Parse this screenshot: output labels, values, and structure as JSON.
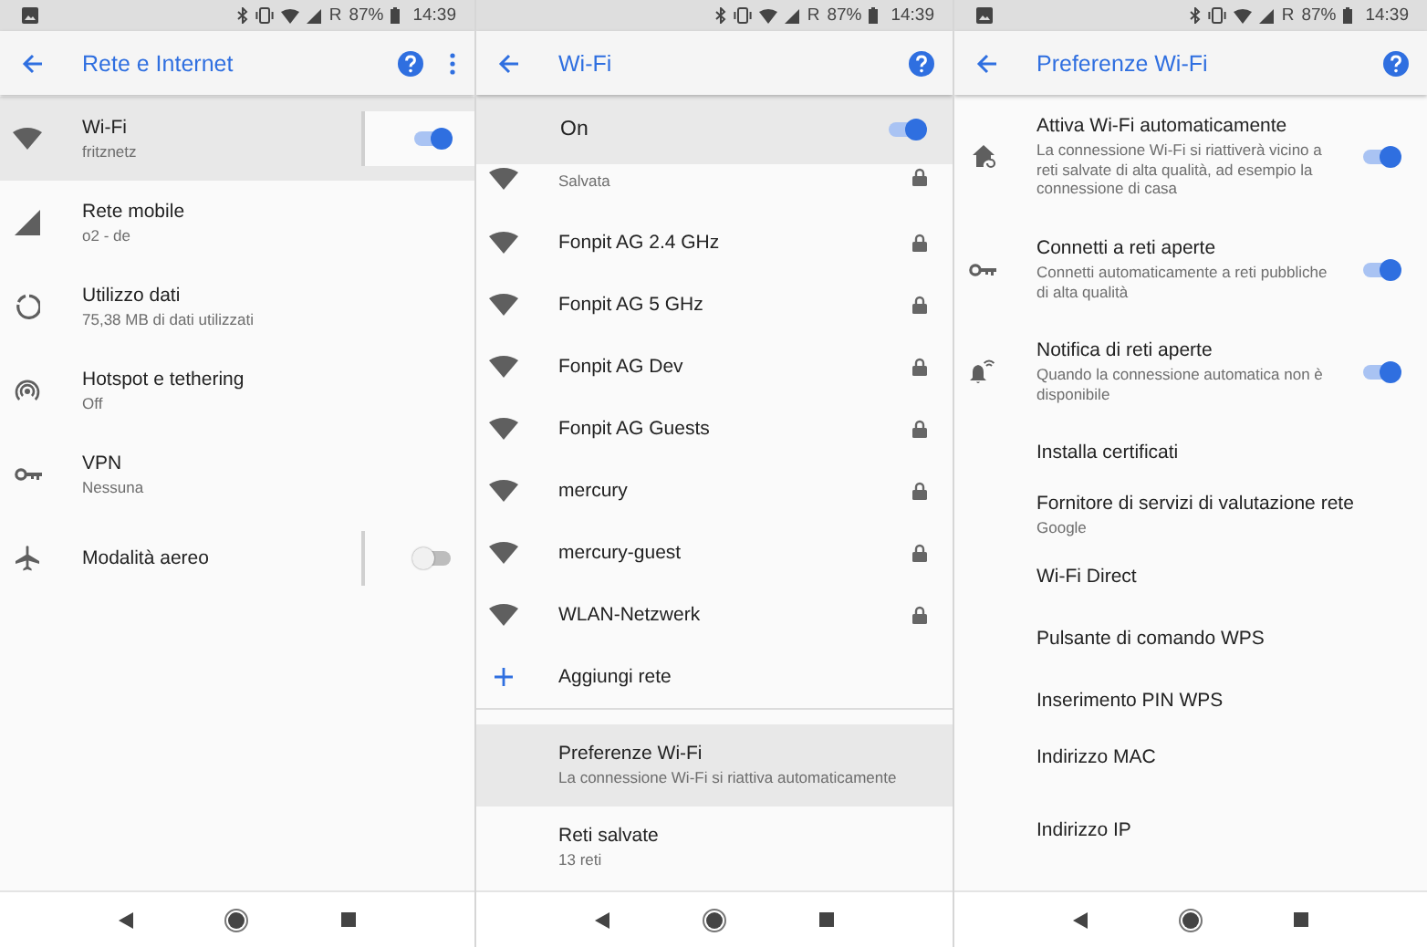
{
  "screens": [
    {
      "status_bar": {
        "notification": true,
        "carrier": "R",
        "battery": "87%",
        "time": "14:39"
      },
      "app_bar": {
        "title": "Rete e Internet",
        "help": true,
        "overflow_menu": true
      },
      "items": [
        {
          "title": "Wi-Fi",
          "subtitle": "fritznetz",
          "selected": true,
          "toggle": {
            "on": true
          }
        },
        {
          "title": "Rete mobile",
          "subtitle": "o2 - de",
          "selected": false
        },
        {
          "title": "Utilizzo dati",
          "subtitle": "75,38 MB di dati utilizzati",
          "selected": false
        },
        {
          "title": "Hotspot e tethering",
          "subtitle": "Off",
          "selected": false
        },
        {
          "title": "VPN",
          "subtitle": "Nessuna",
          "selected": false
        },
        {
          "title": "Modalità aereo",
          "selected": false,
          "toggle": {
            "on": false
          }
        }
      ]
    },
    {
      "status_bar": {
        "notification": false,
        "carrier": "R",
        "battery": "87%",
        "time": "14:39"
      },
      "app_bar": {
        "title": "Wi-Fi",
        "help": true,
        "overflow_menu": false
      },
      "switch_bar": {
        "label": "On",
        "on": true
      },
      "networks": [
        {
          "subtitle": "Salvata",
          "secured": true,
          "partial": true
        },
        {
          "name": "Fonpit AG 2.4 GHz",
          "secured": true,
          "partial": false
        },
        {
          "name": "Fonpit AG 5 GHz",
          "secured": true,
          "partial": false
        },
        {
          "name": "Fonpit AG Dev",
          "secured": true,
          "partial": false
        },
        {
          "name": "Fonpit AG Guests",
          "secured": true,
          "partial": false
        },
        {
          "name": "mercury",
          "secured": true,
          "partial": false
        },
        {
          "name": "mercury-guest",
          "secured": true,
          "partial": false
        },
        {
          "name": "WLAN-Netzwerk",
          "secured": true,
          "partial": false
        }
      ],
      "add_network": "Aggiungi rete",
      "items": [
        {
          "title": "Preferenze Wi-Fi",
          "subtitle": "La connessione Wi-Fi si riattiva automaticamente",
          "selected": true
        },
        {
          "title": "Reti salvate",
          "subtitle": "13 reti",
          "selected": false
        }
      ]
    },
    {
      "status_bar": {
        "notification": true,
        "carrier": "R",
        "battery": "87%",
        "time": "14:39"
      },
      "app_bar": {
        "title": "Preferenze Wi-Fi",
        "help": true,
        "overflow_menu": false
      },
      "items": [
        {
          "kind": "toggle",
          "title": "Attiva Wi-Fi automaticamente",
          "subtitle": "La connessione Wi-Fi si riattiverà vicino a reti salvate di alta qualità, ad esempio la connessione di casa",
          "toggle": {
            "on": true
          }
        },
        {
          "kind": "toggle",
          "title": "Connetti a reti aperte",
          "subtitle": "Connetti automaticamente a reti pubbliche di alta qualità",
          "toggle": {
            "on": true
          }
        },
        {
          "kind": "toggle",
          "title": "Notifica di reti aperte",
          "subtitle": "Quando la connessione automatica non è disponibile",
          "toggle": {
            "on": true
          }
        },
        {
          "kind": "plain",
          "title": "Installa certificati"
        },
        {
          "kind": "plain",
          "title": "Fornitore di servizi di valutazione rete",
          "subtitle": "Google"
        },
        {
          "kind": "plain",
          "title": "Wi-Fi Direct"
        },
        {
          "kind": "plain",
          "title": "Pulsante di comando WPS"
        },
        {
          "kind": "plain",
          "title": "Inserimento PIN WPS"
        },
        {
          "kind": "address",
          "title": "Indirizzo MAC"
        },
        {
          "kind": "address",
          "title": "Indirizzo IP"
        }
      ]
    }
  ]
}
